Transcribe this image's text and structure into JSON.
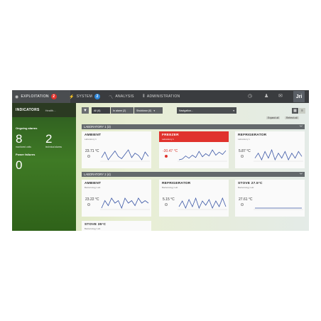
{
  "nav": {
    "tabs": [
      {
        "label": "EXPLOITATION",
        "badge": "2",
        "badge_color": "#e0332d"
      },
      {
        "label": "SYSTEM",
        "badge": "2",
        "badge_color": "#2e86d8"
      },
      {
        "label": "ANALYSIS",
        "badge": ""
      },
      {
        "label": "ADMINISTRATION",
        "badge": ""
      }
    ],
    "logo": "Jri"
  },
  "indicators": {
    "title": "INDICATORS",
    "subtitle": "Health...",
    "ongoing_label": "Ongoing alarms",
    "monitored_count": "8",
    "monitored_label": "monitored units",
    "technical_count": "2",
    "technical_label": "technical alarms",
    "power_label": "Power failures",
    "power_count": "0"
  },
  "toolbar": {
    "segments": [
      "All (6)",
      "In alarm (2)",
      "Shutdown (0)"
    ],
    "select_label": "Navigation...",
    "expand_label": "Expand all",
    "refresh_label": "Refresh all"
  },
  "sections": [
    {
      "title": "LABORATORY 1 (3)",
      "cards": [
        {
          "title": "AMBIENT",
          "sub": "Laboratory 1",
          "value": "23.71 °C",
          "alarm": false,
          "trend": [
            5,
            5.5,
            4.8,
            5.2,
            5.6,
            5.1,
            4.9,
            5.3,
            5.7,
            5.0,
            5.4,
            5.2,
            4.8,
            5.5,
            5.1
          ]
        },
        {
          "title": "FREEZER",
          "sub": "Laboratory 1",
          "value": "-30.47 °C",
          "alarm": true,
          "trend": [
            3,
            4,
            8,
            5,
            9,
            6,
            14,
            7,
            11,
            8,
            16,
            9,
            13,
            10,
            15
          ]
        },
        {
          "title": "REFRIGERATOR",
          "sub": "Laboratory 1",
          "value": "5.87 °C",
          "alarm": false,
          "trend": [
            6,
            9,
            5,
            10,
            6,
            11,
            5,
            9,
            6,
            10,
            5,
            9,
            6,
            10,
            7
          ]
        }
      ]
    },
    {
      "title": "LABORATORY 2 (4)",
      "cards": [
        {
          "title": "AMBIENT",
          "sub": "Bacteriology Lab",
          "value": "23.22 °C",
          "alarm": false,
          "trend": [
            6,
            6.3,
            6.1,
            6.4,
            6.2,
            6.3,
            6.0,
            6.4,
            6.2,
            6.3,
            6.1,
            6.4,
            6.2,
            6.3,
            6.2
          ]
        },
        {
          "title": "REFRIGERATOR",
          "sub": "Bacteriology Lab",
          "value": "5.15 °C",
          "alarm": false,
          "trend": [
            6,
            10,
            5,
            11,
            6,
            12,
            5,
            10,
            7,
            11,
            5,
            10,
            6,
            12,
            6
          ]
        },
        {
          "title": "STOVE 27.5°C",
          "sub": "Bacteriology Lab",
          "value": "27.61 °C",
          "alarm": false,
          "trend": [
            7,
            7,
            7,
            7,
            7,
            7,
            7,
            7,
            7,
            7,
            7,
            7,
            7,
            7,
            7
          ]
        },
        {
          "title": "STOVE 35°C",
          "sub": "Bacteriology Lab",
          "value": "",
          "alarm": false,
          "trend": []
        }
      ]
    }
  ],
  "colors": {
    "alarm": "#e0332d",
    "line": "#3b57a6",
    "accent": "#2e86d8"
  }
}
